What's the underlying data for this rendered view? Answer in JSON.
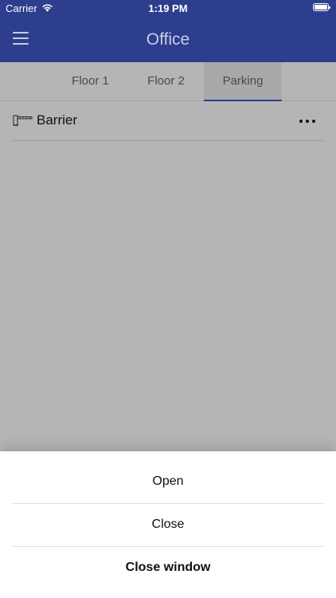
{
  "status_bar": {
    "carrier": "Carrier",
    "time": "1:19 PM",
    "wifi_icon": "wifi-icon",
    "battery_icon": "battery-icon"
  },
  "app_bar": {
    "title": "Office",
    "menu_icon": "menu-icon",
    "background": "#2e3e8e"
  },
  "tabs": [
    {
      "label": "Floor 1",
      "selected": false
    },
    {
      "label": "Floor 2",
      "selected": false
    },
    {
      "label": "Parking",
      "selected": true
    }
  ],
  "list": {
    "items": [
      {
        "label": "Barrier",
        "icon": "barrier-gate-icon",
        "action_icon": "more-options-icon"
      }
    ]
  },
  "action_sheet": {
    "options": [
      {
        "label": "Open"
      },
      {
        "label": "Close"
      },
      {
        "label": "Close window"
      }
    ]
  }
}
